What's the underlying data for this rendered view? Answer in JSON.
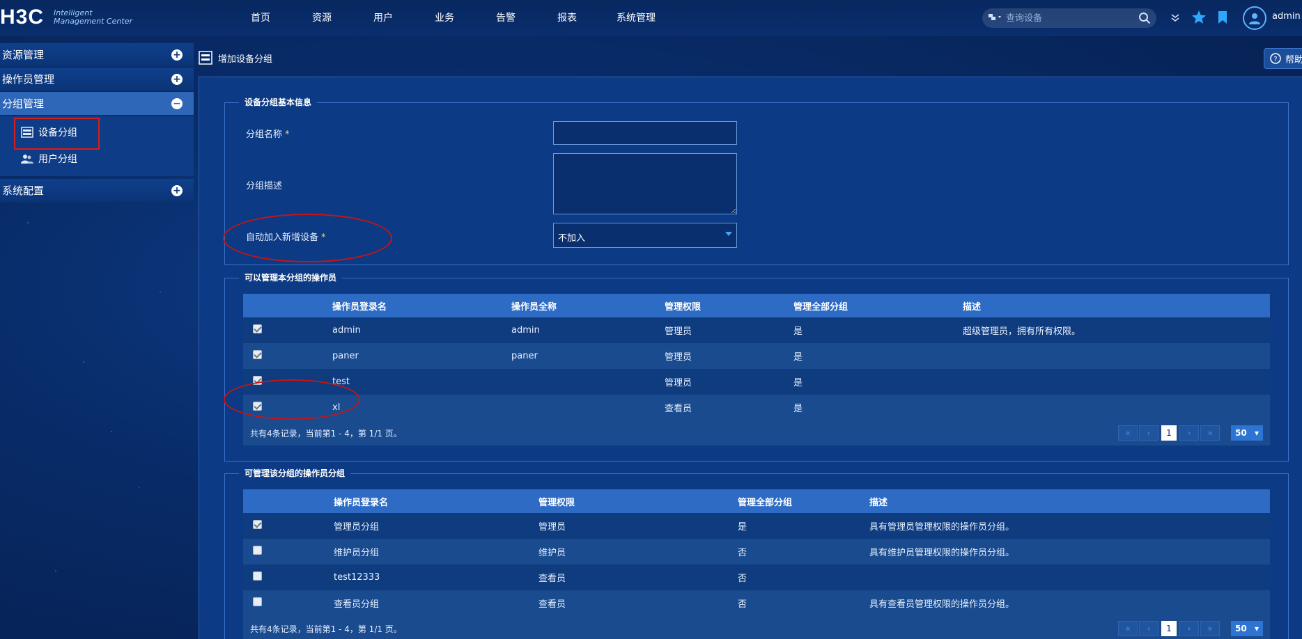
{
  "app": {
    "logo_mark": "H3C",
    "logo_line1": "Intelligent",
    "logo_line2": "Management Center"
  },
  "nav": {
    "items": [
      "首页",
      "资源",
      "用户",
      "业务",
      "告警",
      "报表",
      "系统管理"
    ]
  },
  "search": {
    "placeholder": "查询设备"
  },
  "user": {
    "name": "admin"
  },
  "sidebar": {
    "sections": [
      "资源管理",
      "操作员管理",
      "分组管理",
      "系统配置"
    ],
    "sub_items": [
      "设备分组",
      "用户分组"
    ]
  },
  "page": {
    "title": "增加设备分组",
    "help": "帮助"
  },
  "basic_info": {
    "legend": "设备分组基本信息",
    "name_label": "分组名称",
    "desc_label": "分组描述",
    "auto_label": "自动加入新增设备",
    "required_mark": "*",
    "name_value": "",
    "desc_value": "",
    "auto_value": "不加入"
  },
  "operators": {
    "legend": "可以管理本分组的操作员",
    "columns": [
      "操作员登录名",
      "操作员全称",
      "管理权限",
      "管理全部分组",
      "描述"
    ],
    "rows": [
      [
        "admin",
        "admin",
        "管理员",
        "是",
        "超级管理员，拥有所有权限。"
      ],
      [
        "paner",
        "paner",
        "管理员",
        "是",
        ""
      ],
      [
        "test",
        "",
        "管理员",
        "是",
        ""
      ],
      [
        "xl",
        "",
        "查看员",
        "是",
        ""
      ]
    ],
    "checked": [
      true,
      true,
      true,
      true
    ],
    "summary": "共有4条记录，当前第1 - 4，第 1/1 页。",
    "page": "1",
    "page_size": "50"
  },
  "operator_groups": {
    "legend": "可管理该分组的操作员分组",
    "columns": [
      "操作员登录名",
      "管理权限",
      "管理全部分组",
      "描述"
    ],
    "rows": [
      [
        "管理员分组",
        "管理员",
        "是",
        "具有管理员管理权限的操作员分组。"
      ],
      [
        "维护员分组",
        "维护员",
        "否",
        "具有维护员管理权限的操作员分组。"
      ],
      [
        "test12333",
        "查看员",
        "否",
        ""
      ],
      [
        "查看员分组",
        "查看员",
        "否",
        "具有查看员管理权限的操作员分组。"
      ]
    ],
    "checked": [
      true,
      false,
      false,
      false
    ],
    "summary": "共有4条记录，当前第1 - 4，第 1/1 页。",
    "page": "1",
    "page_size": "50"
  },
  "colors": {
    "accent": "#2d6bc4",
    "annotation": "#c81414"
  }
}
